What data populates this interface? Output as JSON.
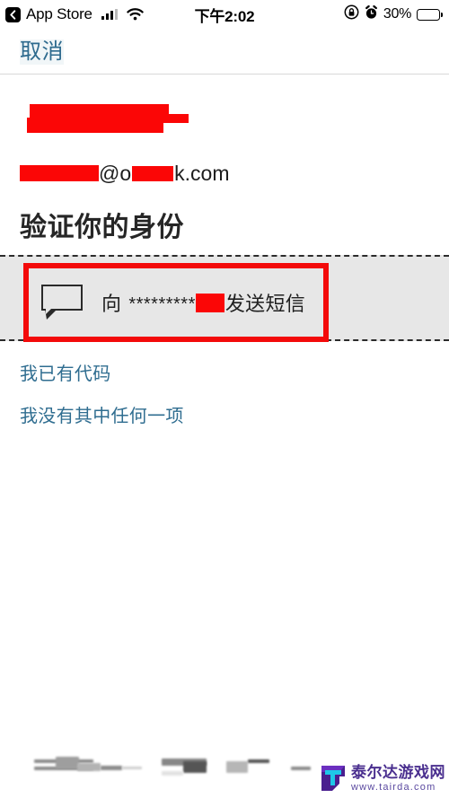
{
  "status_bar": {
    "back_label": "App Store",
    "back_icon": "chevron-left-icon",
    "signal_icon": "cellular-signal-icon",
    "wifi_icon": "wifi-icon",
    "time": "下午2:02",
    "rotation_lock_icon": "rotation-lock-icon",
    "alarm_icon": "alarm-clock-icon",
    "battery_percent": "30%",
    "battery_level": 30
  },
  "nav": {
    "cancel_label": "取消"
  },
  "account": {
    "name_redacted": true,
    "email_prefix_redacted": true,
    "email_at": "@",
    "email_domain_head": "o",
    "email_domain_tail": "k",
    "email_suffix": ".com"
  },
  "main": {
    "heading": "验证你的身份",
    "option": {
      "icon": "speech-bubble-icon",
      "text_prefix": "向",
      "masked_phone": "*********",
      "phone_redacted": true,
      "text_suffix": "发送短信",
      "highlight_color": "#f30a0a",
      "background_color": "#e7e7e7"
    },
    "links": [
      {
        "label": "我已有代码"
      },
      {
        "label": "我没有其中任何一项"
      }
    ],
    "link_color": "#2f6d90"
  },
  "watermark": {
    "logo_icon": "tairda-t-logo-icon",
    "site_name": "泰尔达游戏网",
    "site_url": "www.tairda.com"
  }
}
